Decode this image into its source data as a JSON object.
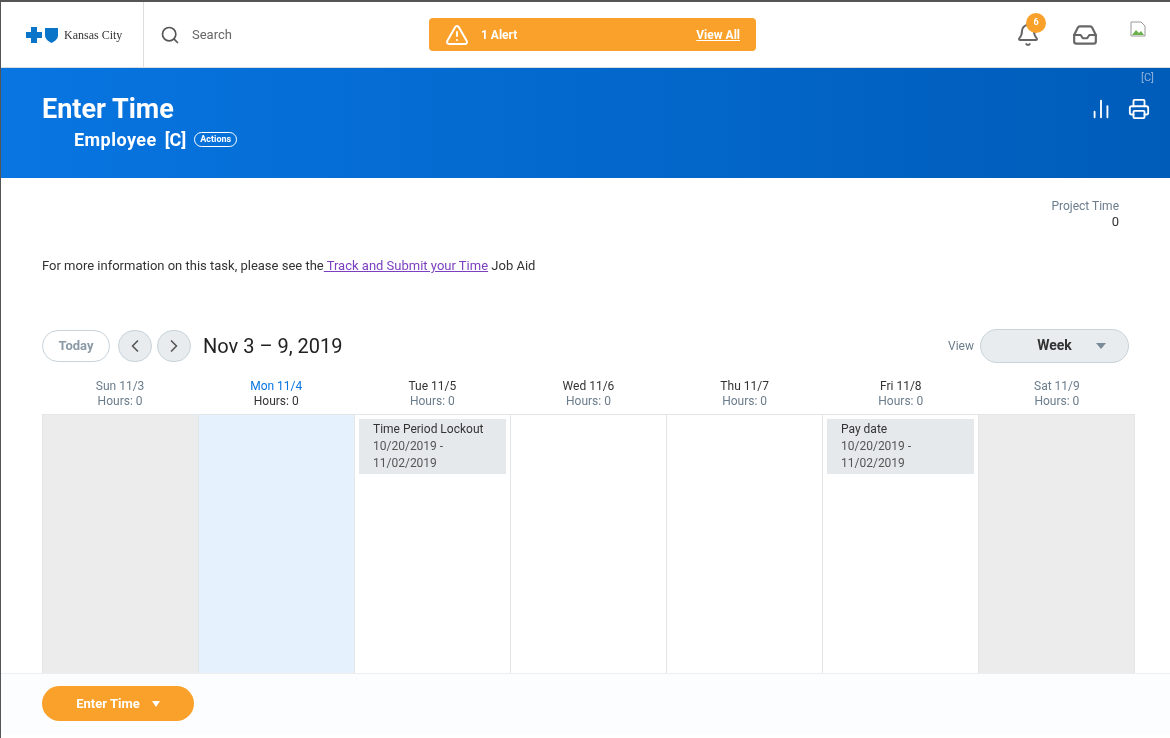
{
  "topbar": {
    "logo_text": "Kansas City",
    "search": {
      "placeholder": "Search"
    },
    "alert": {
      "label": "1 Alert",
      "link": "View All"
    },
    "notifications": {
      "count": "6"
    }
  },
  "header": {
    "corner_tag": "[C]",
    "title": "Enter Time",
    "subtitle": "Employee",
    "subtitle_tag": "[C]",
    "actions": "Actions"
  },
  "project_time": {
    "label": "Project Time",
    "value": "0"
  },
  "info": {
    "before": "For more information on this task, please see the",
    "link": " Track and Submit your Time",
    "after": " Job Aid"
  },
  "calendar": {
    "today": "Today",
    "range": "Nov 3 – 9, 2019",
    "view_label": "View",
    "view": "Week",
    "days": [
      {
        "kind": "weekend",
        "label": "Sun 11/3",
        "hours": "Hours: 0",
        "selected": false
      },
      {
        "kind": "weekday",
        "label": "Mon 11/4",
        "hours": "Hours: 0",
        "selected": true
      },
      {
        "kind": "weekday",
        "label": "Tue 11/5",
        "hours": "Hours: 0",
        "selected": false,
        "events": [
          {
            "title": "Time Period Lockout",
            "dates": "10/20/2019 - 11/02/2019"
          }
        ]
      },
      {
        "kind": "weekday",
        "label": "Wed 11/6",
        "hours": "Hours: 0",
        "selected": false
      },
      {
        "kind": "weekday",
        "label": "Thu 11/7",
        "hours": "Hours: 0",
        "selected": false
      },
      {
        "kind": "weekday",
        "label": "Fri 11/8",
        "hours": "Hours: 0",
        "selected": false,
        "events": [
          {
            "title": "Pay date",
            "dates": "10/20/2019 - 11/02/2019"
          }
        ]
      },
      {
        "kind": "weekend",
        "label": "Sat 11/9",
        "hours": "Hours: 0",
        "selected": false
      }
    ]
  },
  "footer": {
    "button": "Enter Time"
  }
}
